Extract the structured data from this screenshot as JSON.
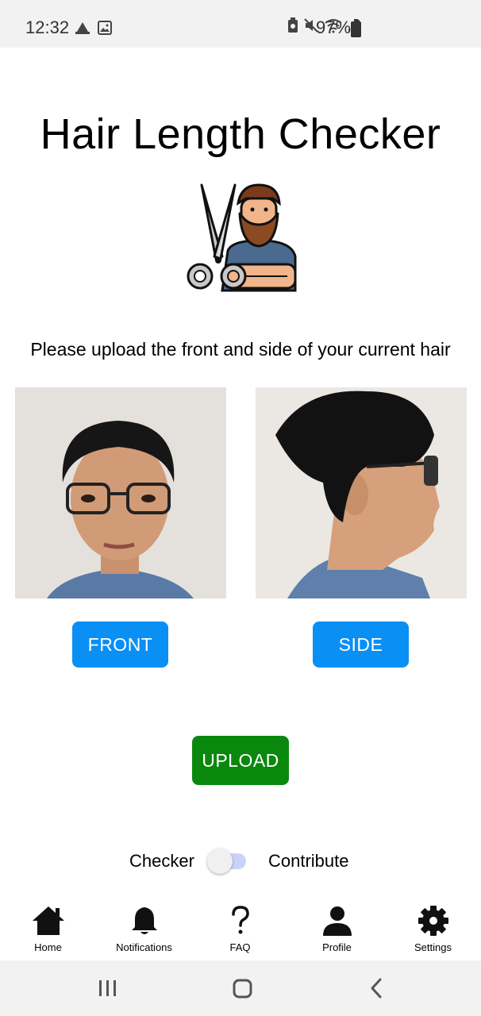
{
  "status_bar": {
    "time": "12:32",
    "battery": "97%"
  },
  "title": "Hair Length Checker",
  "instruction": "Please upload the front and side of your current hair",
  "buttons": {
    "front": "FRONT",
    "side": "SIDE",
    "upload": "UPLOAD"
  },
  "toggle": {
    "left_label": "Checker",
    "right_label": "Contribute",
    "state": "off"
  },
  "tabs": [
    {
      "label": "Home",
      "icon": "home-icon"
    },
    {
      "label": "Notifications",
      "icon": "bell-icon"
    },
    {
      "label": "FAQ",
      "icon": "question-icon"
    },
    {
      "label": "Profile",
      "icon": "person-icon"
    },
    {
      "label": "Settings",
      "icon": "gear-icon"
    }
  ],
  "colors": {
    "blue_button": "#0a8ff5",
    "green_button": "#0a880e"
  }
}
